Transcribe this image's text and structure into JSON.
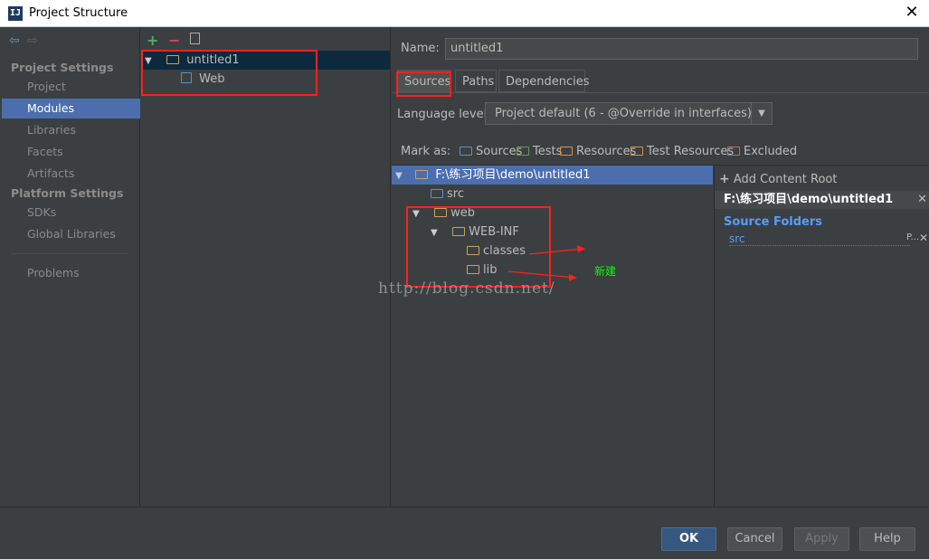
{
  "window": {
    "title": "Project Structure",
    "close": "✕"
  },
  "nav": {
    "sections": [
      {
        "label": "Project Settings",
        "items": [
          "Project",
          "Modules",
          "Libraries",
          "Facets",
          "Artifacts"
        ]
      },
      {
        "label": "Platform Settings",
        "items": [
          "SDKs",
          "Global Libraries"
        ]
      }
    ],
    "selected": "Modules",
    "problems": "Problems"
  },
  "modules": {
    "root": "untitled1",
    "child": "Web"
  },
  "name": {
    "label": "Name:",
    "value": "untitled1"
  },
  "tabs": [
    "Sources",
    "Paths",
    "Dependencies"
  ],
  "active_tab": "Sources",
  "language": {
    "label": "Language level:",
    "value": "Project default (6 - @Override in interfaces)"
  },
  "mark_as": {
    "label": "Mark as:",
    "items": [
      "Sources",
      "Tests",
      "Resources",
      "Test Resources",
      "Excluded"
    ]
  },
  "content_tree": {
    "root": "F:\\练习项目\\demo\\untitled1",
    "src": "src",
    "web": "web",
    "webinf": "WEB-INF",
    "classes": "classes",
    "lib": "lib"
  },
  "content_root": {
    "add_label": "Add Content Root",
    "path": "F:\\练习项目\\demo\\untitled1",
    "source_folders_label": "Source Folders",
    "source_entry": "src",
    "entry_flag": "P..."
  },
  "buttons": {
    "ok": "OK",
    "cancel": "Cancel",
    "apply": "Apply",
    "help": "Help"
  },
  "watermark": "http://blog.csdn.net/",
  "annotation": "新建",
  "colors": {
    "selection": "#4b6eaf",
    "annotation_box": "#ff2020",
    "annotation_text": "#00ff00"
  }
}
